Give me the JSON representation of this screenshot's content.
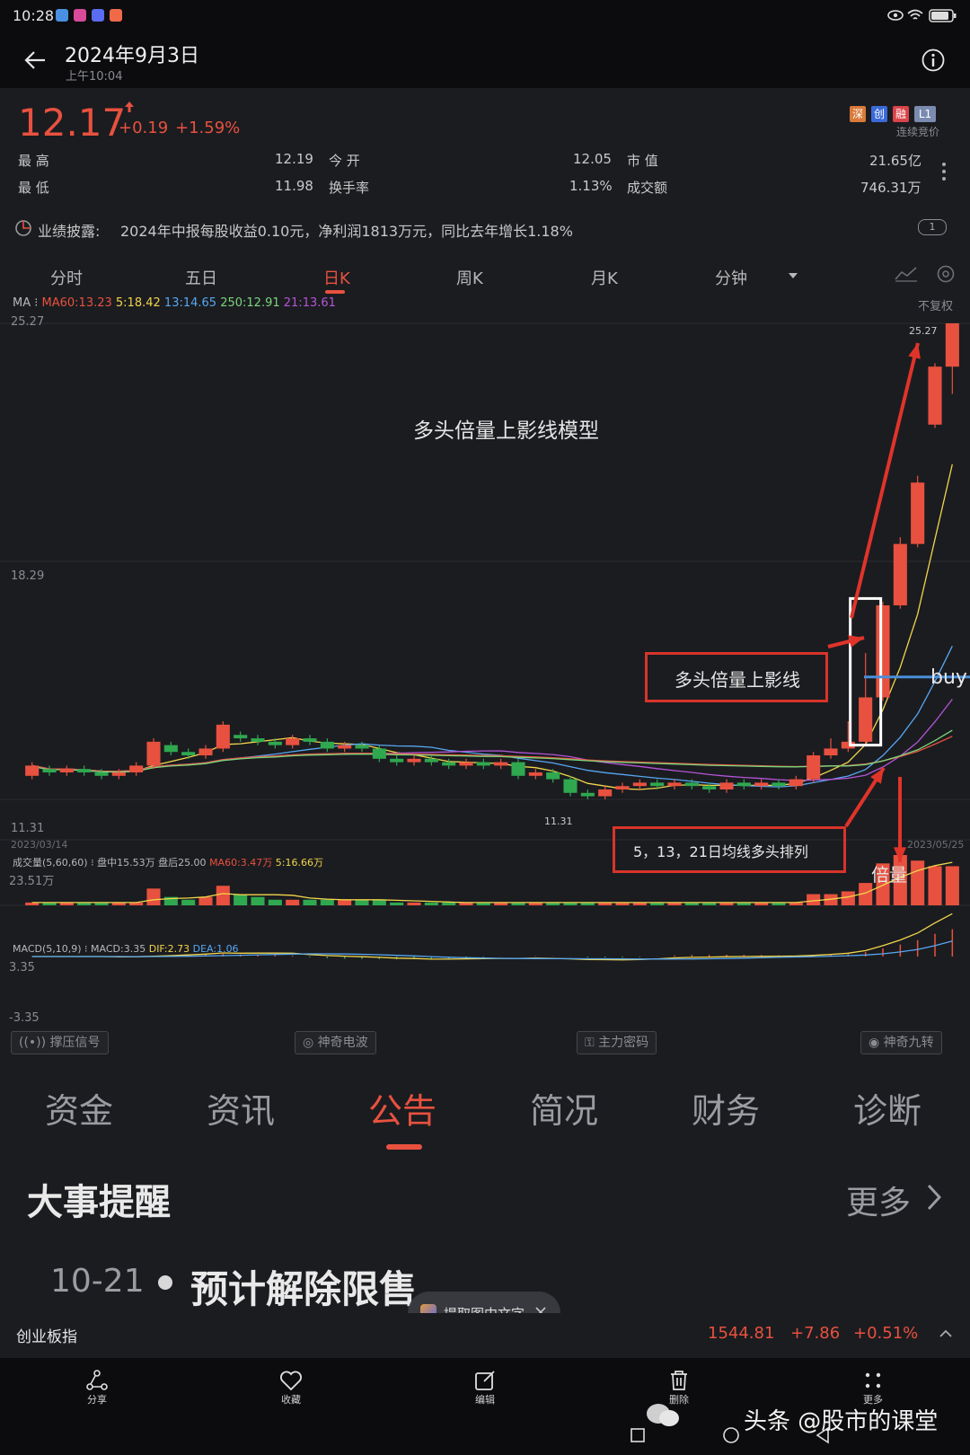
{
  "status_bar": {
    "time": "10:28"
  },
  "header": {
    "title": "2024年9月3日",
    "subtitle": "上午10:04",
    "back_icon": "arrow-left-icon",
    "info_icon": "info-icon"
  },
  "quote": {
    "price": "12.17",
    "change": "+0.19",
    "change_pct": "+1.59%",
    "badges": [
      "深",
      "创",
      "融",
      "L1"
    ],
    "auction_label": "连续竞价",
    "high_label": "最  高",
    "high": "12.19",
    "low_label": "最  低",
    "low": "11.98",
    "open_label": "今  开",
    "open": "12.05",
    "turnover_rate_label": "换手率",
    "turnover_rate": "1.13%",
    "mkt_cap_label": "市  值",
    "mkt_cap": "21.65亿",
    "amount_label": "成交额",
    "amount": "746.31万"
  },
  "notice": {
    "label": "业绩披露:",
    "text": "2024年中报每股收益0.10元，净利润1813万元，同比去年增长1.18%",
    "badge": "1"
  },
  "period_tabs": [
    {
      "label": "分时",
      "active": false
    },
    {
      "label": "五日",
      "active": false
    },
    {
      "label": "日K",
      "active": true
    },
    {
      "label": "周K",
      "active": false
    },
    {
      "label": "月K",
      "active": false
    },
    {
      "label": "分钟",
      "active": false
    }
  ],
  "chart_header": {
    "ma_prefix": "MA",
    "ma60": "MA60:13.23",
    "ma5": "5:18.42",
    "ma13": "13:14.65",
    "ma250": "250:12.91",
    "ma21": "21:13.61",
    "adjust": "不复权"
  },
  "chart_data": {
    "type": "candlestick",
    "price_axis_labels": [
      "25.27",
      "18.29",
      "11.31"
    ],
    "ylim": [
      11.31,
      25.27
    ],
    "start_date": "2023/03/14",
    "end_date": "2023/05/25",
    "high_marker": "25.27",
    "low_marker": "11.31",
    "candles": [
      {
        "o": 12.0,
        "c": 12.3,
        "h": 12.4,
        "l": 11.9
      },
      {
        "o": 12.2,
        "c": 12.1,
        "h": 12.3,
        "l": 12.0
      },
      {
        "o": 12.1,
        "c": 12.2,
        "h": 12.3,
        "l": 12.0
      },
      {
        "o": 12.2,
        "c": 12.1,
        "h": 12.3,
        "l": 12.0
      },
      {
        "o": 12.1,
        "c": 12.0,
        "h": 12.2,
        "l": 11.9
      },
      {
        "o": 12.0,
        "c": 12.1,
        "h": 12.2,
        "l": 11.9
      },
      {
        "o": 12.1,
        "c": 12.3,
        "h": 12.4,
        "l": 12.0
      },
      {
        "o": 12.3,
        "c": 13.0,
        "h": 13.1,
        "l": 12.2
      },
      {
        "o": 12.9,
        "c": 12.7,
        "h": 13.0,
        "l": 12.6
      },
      {
        "o": 12.7,
        "c": 12.6,
        "h": 12.8,
        "l": 12.5
      },
      {
        "o": 12.6,
        "c": 12.8,
        "h": 12.9,
        "l": 12.5
      },
      {
        "o": 12.8,
        "c": 13.5,
        "h": 13.6,
        "l": 12.7
      },
      {
        "o": 13.2,
        "c": 13.1,
        "h": 13.3,
        "l": 13.0
      },
      {
        "o": 13.1,
        "c": 13.0,
        "h": 13.2,
        "l": 12.9
      },
      {
        "o": 13.0,
        "c": 12.9,
        "h": 13.1,
        "l": 12.8
      },
      {
        "o": 12.9,
        "c": 13.1,
        "h": 13.2,
        "l": 12.8
      },
      {
        "o": 13.1,
        "c": 13.0,
        "h": 13.2,
        "l": 12.9
      },
      {
        "o": 13.0,
        "c": 12.8,
        "h": 13.1,
        "l": 12.7
      },
      {
        "o": 12.8,
        "c": 12.9,
        "h": 13.0,
        "l": 12.7
      },
      {
        "o": 12.9,
        "c": 12.8,
        "h": 13.0,
        "l": 12.7
      },
      {
        "o": 12.8,
        "c": 12.5,
        "h": 12.9,
        "l": 12.4
      },
      {
        "o": 12.5,
        "c": 12.4,
        "h": 12.6,
        "l": 12.3
      },
      {
        "o": 12.4,
        "c": 12.5,
        "h": 12.6,
        "l": 12.3
      },
      {
        "o": 12.5,
        "c": 12.4,
        "h": 12.6,
        "l": 12.3
      },
      {
        "o": 12.4,
        "c": 12.3,
        "h": 12.5,
        "l": 12.2
      },
      {
        "o": 12.3,
        "c": 12.4,
        "h": 12.5,
        "l": 12.2
      },
      {
        "o": 12.4,
        "c": 12.3,
        "h": 12.5,
        "l": 12.2
      },
      {
        "o": 12.3,
        "c": 12.4,
        "h": 12.5,
        "l": 12.2
      },
      {
        "o": 12.4,
        "c": 12.0,
        "h": 12.5,
        "l": 11.9
      },
      {
        "o": 12.0,
        "c": 12.1,
        "h": 12.2,
        "l": 11.9
      },
      {
        "o": 12.1,
        "c": 11.9,
        "h": 12.2,
        "l": 11.8
      },
      {
        "o": 11.9,
        "c": 11.5,
        "h": 12.0,
        "l": 11.4
      },
      {
        "o": 11.5,
        "c": 11.4,
        "h": 11.6,
        "l": 11.31
      },
      {
        "o": 11.4,
        "c": 11.6,
        "h": 11.7,
        "l": 11.31
      },
      {
        "o": 11.6,
        "c": 11.7,
        "h": 11.8,
        "l": 11.5
      },
      {
        "o": 11.7,
        "c": 11.8,
        "h": 11.9,
        "l": 11.6
      },
      {
        "o": 11.8,
        "c": 11.7,
        "h": 11.9,
        "l": 11.6
      },
      {
        "o": 11.7,
        "c": 11.8,
        "h": 11.9,
        "l": 11.6
      },
      {
        "o": 11.8,
        "c": 11.7,
        "h": 11.9,
        "l": 11.6
      },
      {
        "o": 11.7,
        "c": 11.6,
        "h": 11.8,
        "l": 11.5
      },
      {
        "o": 11.6,
        "c": 11.8,
        "h": 11.9,
        "l": 11.5
      },
      {
        "o": 11.8,
        "c": 11.7,
        "h": 11.9,
        "l": 11.6
      },
      {
        "o": 11.7,
        "c": 11.8,
        "h": 11.9,
        "l": 11.6
      },
      {
        "o": 11.8,
        "c": 11.7,
        "h": 11.9,
        "l": 11.6
      },
      {
        "o": 11.7,
        "c": 11.9,
        "h": 12.0,
        "l": 11.6
      },
      {
        "o": 11.9,
        "c": 12.6,
        "h": 12.7,
        "l": 11.8
      },
      {
        "o": 12.6,
        "c": 12.8,
        "h": 13.1,
        "l": 12.5
      },
      {
        "o": 12.8,
        "c": 13.0,
        "h": 13.6,
        "l": 12.7
      },
      {
        "o": 13.0,
        "c": 14.3,
        "h": 15.6,
        "l": 12.9
      },
      {
        "o": 14.3,
        "c": 17.0,
        "h": 17.1,
        "l": 14.2
      },
      {
        "o": 17.0,
        "c": 18.8,
        "h": 19.0,
        "l": 16.9
      },
      {
        "o": 18.8,
        "c": 20.6,
        "h": 20.8,
        "l": 18.7
      },
      {
        "o": 22.3,
        "c": 24.0,
        "h": 24.1,
        "l": 22.2
      },
      {
        "o": 24.0,
        "c": 25.27,
        "h": 25.27,
        "l": 23.2
      }
    ],
    "volume_label": "成交量(5,60,60)",
    "volume_panel_values": "盘中15.53万 盘后25.00",
    "volume_ma60": "MA60:3.47万",
    "volume_ma5": "5:16.66万",
    "volume_axis_max": "23.51万",
    "volumes": [
      1,
      1,
      1,
      1,
      1,
      1,
      1,
      6,
      3,
      2,
      3,
      7,
      4,
      3,
      2,
      2,
      2,
      2,
      2,
      2,
      2,
      1,
      1,
      1,
      1,
      1,
      1,
      1,
      1,
      1,
      1,
      1,
      1,
      1,
      1,
      1,
      1,
      1,
      1,
      1,
      1,
      1,
      1,
      1,
      1,
      4,
      4,
      5,
      8,
      15,
      18,
      16,
      14,
      14
    ],
    "macd_label": "MACD(5,10,9)",
    "macd": "MACD:3.35",
    "dif": "DIF:2.73",
    "dea": "DEA:1.06",
    "macd_axis_max": "3.35",
    "macd_axis_min": "-3.35"
  },
  "annotations": {
    "model_title": "多头倍量上影线模型",
    "box_label": "多头倍量上影线",
    "ma_label": "5，13，21日均线多头排列",
    "buy_label": "buy",
    "volume_label": "倍量"
  },
  "indicator_buttons": [
    "撑压信号",
    "神奇电波",
    "主力密码",
    "神奇九转"
  ],
  "section_tabs": [
    {
      "label": "资金",
      "active": false
    },
    {
      "label": "资讯",
      "active": false
    },
    {
      "label": "公告",
      "active": true
    },
    {
      "label": "简况",
      "active": false
    },
    {
      "label": "财务",
      "active": false
    },
    {
      "label": "诊断",
      "active": false
    }
  ],
  "events": {
    "title": "大事提醒",
    "more": "更多",
    "first_date": "10-21",
    "first_title": "预计解除限售"
  },
  "ocr_pill": {
    "label": "提取图中文字"
  },
  "index_bar": {
    "name": "创业板指",
    "value": "1544.81",
    "change": "+7.86",
    "change_pct": "+0.51%"
  },
  "toolbar": [
    {
      "label": "分享",
      "icon": "share-icon"
    },
    {
      "label": "收藏",
      "icon": "heart-icon"
    },
    {
      "label": "编辑",
      "icon": "edit-icon"
    },
    {
      "label": "删除",
      "icon": "trash-icon"
    },
    {
      "label": "更多",
      "icon": "more-icon"
    }
  ],
  "watermark": {
    "text": "头条 @股市的课堂"
  }
}
